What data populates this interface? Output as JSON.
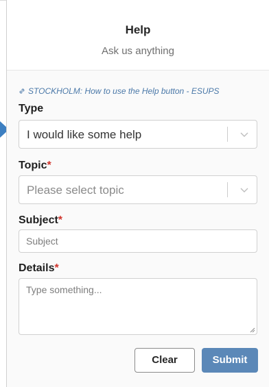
{
  "header": {
    "title": "Help",
    "subtitle": "Ask us anything"
  },
  "help_link": {
    "text": "STOCKHOLM: How to use the Help button - ESUPS",
    "icon": "link-icon"
  },
  "form": {
    "type": {
      "label": "Type",
      "value": "I would like some help"
    },
    "topic": {
      "label": "Topic",
      "required_mark": "*",
      "placeholder": "Please select topic"
    },
    "subject": {
      "label": "Subject",
      "required_mark": "*",
      "placeholder": "Subject"
    },
    "details": {
      "label": "Details",
      "required_mark": "*",
      "placeholder": "Type something..."
    }
  },
  "buttons": {
    "clear": "Clear",
    "submit": "Submit"
  },
  "colors": {
    "accent": "#5b88b8",
    "required": "#d0342c",
    "link": "#4a78a8",
    "pointer": "#3d7fc1"
  }
}
